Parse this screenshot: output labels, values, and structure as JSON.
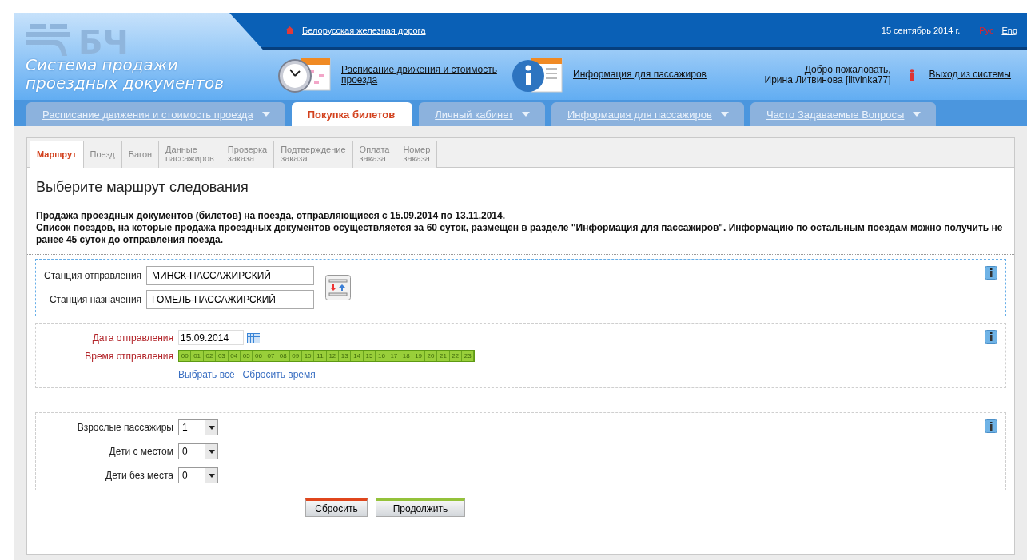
{
  "header": {
    "logo_mark": "БЧ",
    "system_title": "Система продажи проездных документов",
    "home_link": "Белорусская железная дорога",
    "date": "15 сентябрь 2014 г.",
    "languages": [
      {
        "label": "Рус",
        "selected": true
      },
      {
        "label": "Eng",
        "selected": false
      }
    ],
    "quick_links": [
      {
        "kind": "schedule",
        "label": "Расписание движения и стоимость проезда"
      },
      {
        "kind": "info",
        "label": "Информация для пассажиров"
      }
    ],
    "welcome": "Добро пожаловать,",
    "user": "Ирина Литвинова [litvinka77]",
    "logout": "Выход из системы"
  },
  "main_tabs": [
    {
      "label": "Расписание движения и стоимость проезда",
      "selected": false,
      "dropdown": true
    },
    {
      "label": "Покупка билетов",
      "selected": true,
      "dropdown": false
    },
    {
      "label": "Личный кабинет",
      "selected": false,
      "dropdown": true
    },
    {
      "label": "Информация для пассажиров",
      "selected": false,
      "dropdown": true
    },
    {
      "label": "Часто Задаваемые Вопросы",
      "selected": false,
      "dropdown": true
    }
  ],
  "steps": [
    {
      "label": "Маршрут",
      "selected": true
    },
    {
      "label": "Поезд",
      "selected": false
    },
    {
      "label": "Вагон",
      "selected": false
    },
    {
      "label": "Данные пассажиров",
      "selected": false
    },
    {
      "label": "Проверка заказа",
      "selected": false
    },
    {
      "label": "Подтверждение заказа",
      "selected": false
    },
    {
      "label": "Оплата заказа",
      "selected": false
    },
    {
      "label": "Номер заказа",
      "selected": false
    }
  ],
  "heading": "Выберите маршрут следования",
  "notice": [
    "Продажа проездных документов (билетов) на поезда, отправляющиеся с 15.09.2014 по 13.11.2014.",
    "Список поездов, на которые продажа проездных документов осуществляется за 60 суток, размещен в разделе \"Информация для пассажиров\". Информацию по остальным поездам можно получить не ранее 45 суток до отправления поезда."
  ],
  "stations": {
    "focused": true,
    "from_label": "Станция отправления",
    "from": "МИНСК-ПАССАЖИРСКИЙ",
    "to_label": "Станция назначения",
    "to": "ГОМЕЛЬ-ПАССАЖИРСКИЙ"
  },
  "datetime": {
    "focused": false,
    "date_label": "Дата отправления",
    "date": "15.09.2014",
    "time_label": "Время отправления",
    "hours": [
      {
        "label": "00",
        "selected": true
      },
      {
        "label": "01",
        "selected": true
      },
      {
        "label": "02",
        "selected": true
      },
      {
        "label": "03",
        "selected": true
      },
      {
        "label": "04",
        "selected": true
      },
      {
        "label": "05",
        "selected": true
      },
      {
        "label": "06",
        "selected": true
      },
      {
        "label": "07",
        "selected": true
      },
      {
        "label": "08",
        "selected": true
      },
      {
        "label": "09",
        "selected": true
      },
      {
        "label": "10",
        "selected": true
      },
      {
        "label": "11",
        "selected": true
      },
      {
        "label": "12",
        "selected": true
      },
      {
        "label": "13",
        "selected": true
      },
      {
        "label": "14",
        "selected": true
      },
      {
        "label": "15",
        "selected": true
      },
      {
        "label": "16",
        "selected": true
      },
      {
        "label": "17",
        "selected": true
      },
      {
        "label": "18",
        "selected": true
      },
      {
        "label": "19",
        "selected": true
      },
      {
        "label": "20",
        "selected": true
      },
      {
        "label": "21",
        "selected": true
      },
      {
        "label": "22",
        "selected": true
      },
      {
        "label": "23",
        "selected": true
      }
    ],
    "select_all": "Выбрать всё",
    "reset_time": "Сбросить время"
  },
  "passengers": {
    "focused": false,
    "rows": [
      {
        "label": "Взрослые пассажиры",
        "value": "1"
      },
      {
        "label": "Дети с местом",
        "value": "0"
      },
      {
        "label": "Дети без места",
        "value": "0"
      }
    ]
  },
  "buttons": [
    {
      "kind": "reset",
      "label": "Сбросить"
    },
    {
      "kind": "continue",
      "label": "Продолжить"
    }
  ]
}
